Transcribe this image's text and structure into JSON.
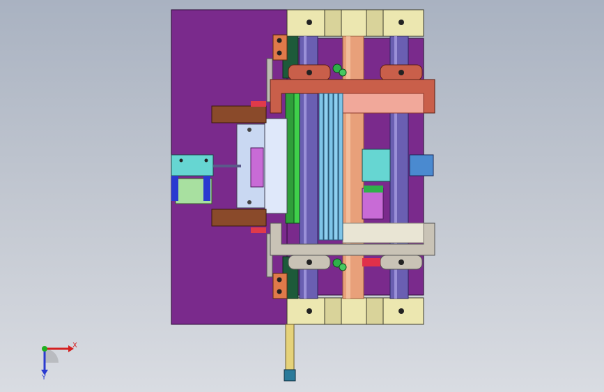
{
  "viewport": {
    "background_top": "#a9b2c1",
    "background_bottom": "#d9dce2"
  },
  "colors": {
    "plate_purple": "#7a2a8c",
    "plate_dark": "#3b1245",
    "bushing_cream": "#ece7b0",
    "bushing_shadow": "#b7b07a",
    "copper_rod": "#e8a07a",
    "copper_rod_dark": "#c77a55",
    "red_frame": "#c95f4a",
    "red_frame_dark": "#8e3a2c",
    "salmon_block": "#f1a89a",
    "grey_frame": "#c9c3b6",
    "grey_frame_dark": "#8c877c",
    "green_plate": "#2f9f3a",
    "dark_green": "#1d5a3a",
    "blue_bar": "#7fc5e8",
    "cyan_block": "#66d6d2",
    "magenta_block": "#c86bd6",
    "brown_bar": "#8a4a2a",
    "violet_rod": "#6a5fb2",
    "yellow_rod": "#e5d27a",
    "light_blue_slide": "#c9d8f2"
  },
  "triad": {
    "x_label": "X",
    "y_label": "Y",
    "x_color": "#d42020",
    "y_color": "#2a3ad0",
    "origin_color": "#20b020"
  }
}
